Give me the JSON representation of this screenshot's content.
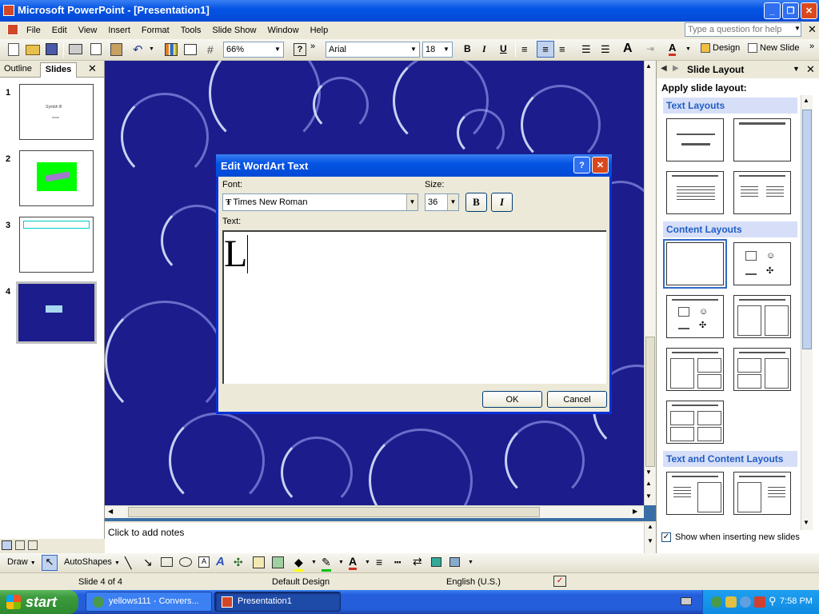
{
  "window": {
    "title": "Microsoft PowerPoint - [Presentation1]"
  },
  "menubar": {
    "items": [
      "File",
      "Edit",
      "View",
      "Insert",
      "Format",
      "Tools",
      "Slide Show",
      "Window",
      "Help"
    ],
    "help_placeholder": "Type a question for help"
  },
  "toolbar": {
    "zoom": "66%",
    "font": "Arial",
    "size": "18",
    "design_label": "Design",
    "new_slide_label": "New Slide"
  },
  "left_pane": {
    "tab_outline": "Outline",
    "tab_slides": "Slides",
    "slides": [
      {
        "num": "1",
        "title": "Symbh lll",
        "sub": "oooo"
      },
      {
        "num": "2"
      },
      {
        "num": "3"
      },
      {
        "num": "4"
      }
    ]
  },
  "notes": {
    "placeholder": "Click to add notes"
  },
  "dialog": {
    "title": "Edit WordArt Text",
    "font_label": "Font:",
    "font_value": "Times New Roman",
    "size_label": "Size:",
    "size_value": "36",
    "bold": "B",
    "italic": "I",
    "text_label": "Text:",
    "text_value": "L",
    "ok": "OK",
    "cancel": "Cancel"
  },
  "task_pane": {
    "title": "Slide Layout",
    "apply": "Apply slide layout:",
    "text_layouts": "Text Layouts",
    "content_layouts": "Content Layouts",
    "text_content_layouts": "Text and Content Layouts",
    "show_when": "Show when inserting new slides"
  },
  "drawing": {
    "draw": "Draw",
    "autoshapes": "AutoShapes"
  },
  "status": {
    "slide": "Slide 4 of 4",
    "design": "Default Design",
    "language": "English (U.S.)"
  },
  "taskbar": {
    "start": "start",
    "items": [
      "yellows111 - Convers...",
      "Presentation1"
    ],
    "clock": "7:58 PM"
  },
  "colors": {
    "titlebar": "#0a246a",
    "slide_bg": "#1c1c8c",
    "taskbar": "#245edb",
    "start": "#3c9a3c",
    "task_pane_header": "#d6dff7"
  }
}
